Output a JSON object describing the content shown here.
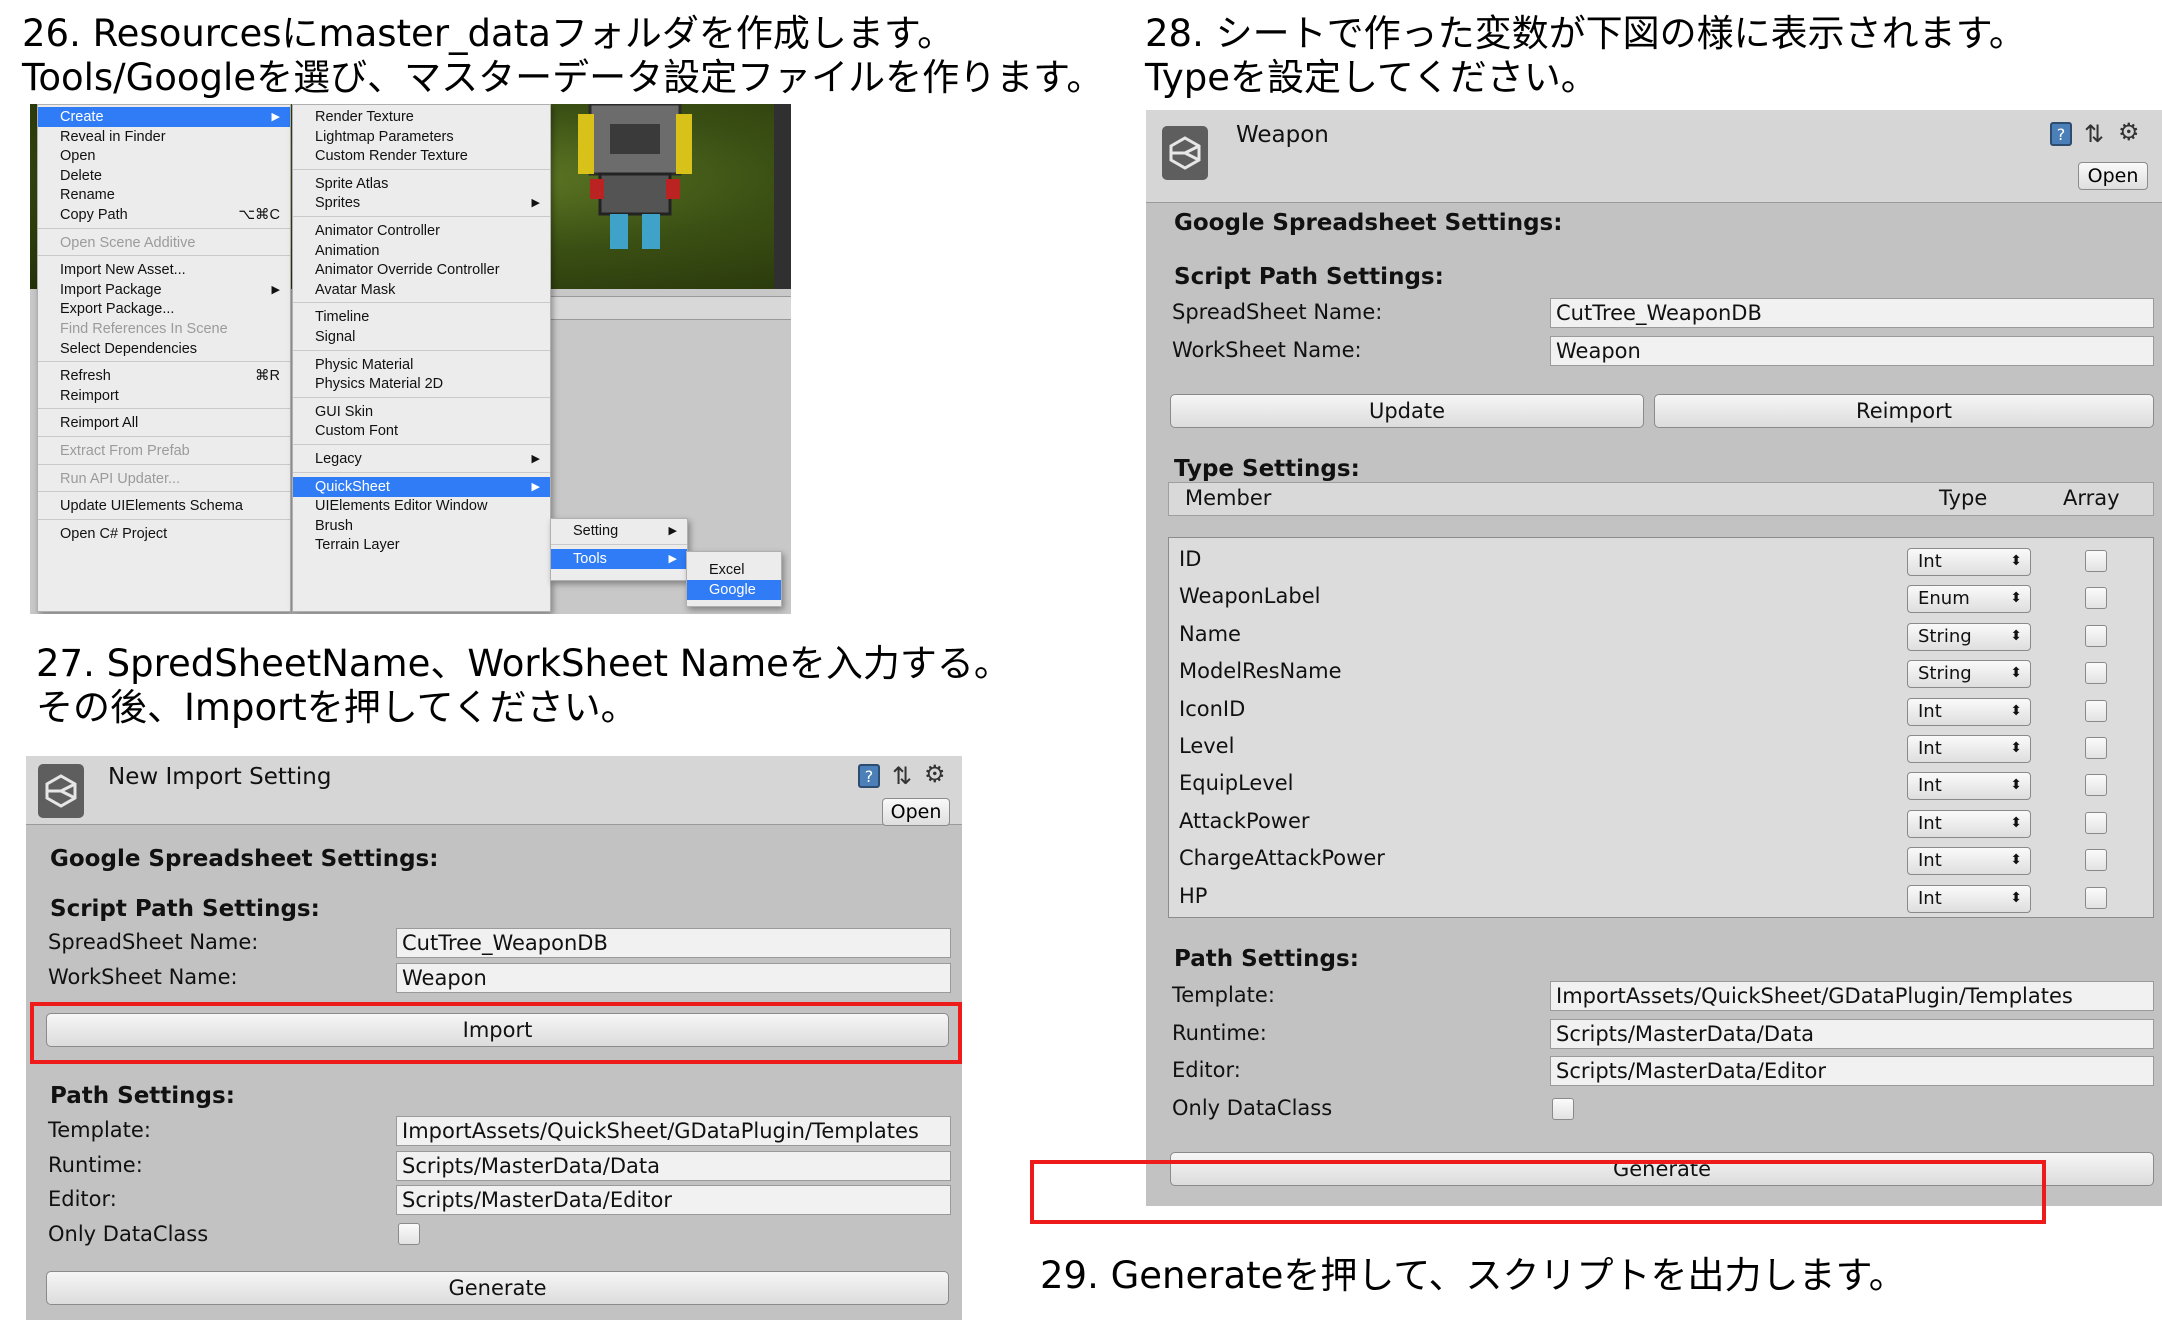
{
  "captions": {
    "step26_line1": "26. Resourcesにmaster_dataフォルダを作成します。",
    "step26_line2": "Tools/Googleを選び、マスターデータ設定ファイルを作ります。",
    "step27_line1": "27. SpredSheetName、WorkSheet Nameを入力する。",
    "step27_line2": "その後、Importを押してください。",
    "step28_line1": "28. シートで作った変数が下図の様に表示されます。",
    "step28_line2": "Typeを設定してください。",
    "step29": "29. Generateを押して、スクリプトを出力します。"
  },
  "context_menu": {
    "main": [
      {
        "label": "Create",
        "selected": true,
        "arrow": "▶"
      },
      {
        "label": "Reveal in Finder"
      },
      {
        "label": "Open"
      },
      {
        "label": "Delete"
      },
      {
        "label": "Rename"
      },
      {
        "label": "Copy Path",
        "shortcut": "⌥⌘C"
      },
      {
        "label": "Open Scene Additive",
        "disabled": true
      },
      {
        "label": "Import New Asset..."
      },
      {
        "label": "Import Package",
        "arrow": "▶"
      },
      {
        "label": "Export Package..."
      },
      {
        "label": "Find References In Scene",
        "disabled": true
      },
      {
        "label": "Select Dependencies"
      },
      {
        "label": "Refresh",
        "shortcut": "⌘R"
      },
      {
        "label": "Reimport"
      },
      {
        "label": "Reimport All"
      },
      {
        "label": "Extract From Prefab",
        "disabled": true
      },
      {
        "label": "Run API Updater...",
        "disabled": true
      },
      {
        "label": "Update UIElements Schema"
      },
      {
        "label": "Open C# Project"
      }
    ],
    "create_sub": [
      {
        "label": "Render Texture"
      },
      {
        "label": "Lightmap Parameters"
      },
      {
        "label": "Custom Render Texture"
      },
      {
        "label": "Sprite Atlas"
      },
      {
        "label": "Sprites",
        "arrow": "▶"
      },
      {
        "label": "Animator Controller"
      },
      {
        "label": "Animation"
      },
      {
        "label": "Animator Override Controller"
      },
      {
        "label": "Avatar Mask"
      },
      {
        "label": "Timeline"
      },
      {
        "label": "Signal"
      },
      {
        "label": "Physic Material"
      },
      {
        "label": "Physics Material 2D"
      },
      {
        "label": "GUI Skin"
      },
      {
        "label": "Custom Font"
      },
      {
        "label": "Legacy",
        "arrow": "▶"
      },
      {
        "label": "QuickSheet",
        "selected": true,
        "arrow": "▶"
      },
      {
        "label": "UIElements Editor Window"
      },
      {
        "label": "Brush"
      },
      {
        "label": "Terrain Layer"
      }
    ],
    "quicksheet_sub": [
      {
        "label": "Setting",
        "arrow": "▶"
      },
      {
        "label": "Tools",
        "selected": true,
        "arrow": "▶"
      }
    ],
    "tools_sub": [
      {
        "label": "Excel"
      },
      {
        "label": "Google",
        "selected": true
      }
    ]
  },
  "import_panel": {
    "title": "New Import Setting",
    "open_label": "Open",
    "help_glyph": "?",
    "google_section": "Google Spreadsheet Settings:",
    "script_path_section": "Script Path Settings:",
    "spreadsheet_label": "SpreadSheet Name:",
    "spreadsheet_value": "CutTree_WeaponDB",
    "worksheet_label": "WorkSheet Name:",
    "worksheet_value": "Weapon",
    "import_label": "Import",
    "path_section": "Path Settings:",
    "template_label": "Template:",
    "template_value": "ImportAssets/QuickSheet/GDataPlugin/Templates",
    "runtime_label": "Runtime:",
    "runtime_value": "Scripts/MasterData/Data",
    "editor_label": "Editor:",
    "editor_value": "Scripts/MasterData/Editor",
    "only_dataclass_label": "Only DataClass",
    "generate_label": "Generate"
  },
  "weapon_panel": {
    "title": "Weapon",
    "open_label": "Open",
    "help_glyph": "?",
    "google_section": "Google Spreadsheet Settings:",
    "script_path_section": "Script Path Settings:",
    "spreadsheet_label": "SpreadSheet Name:",
    "spreadsheet_value": "CutTree_WeaponDB",
    "worksheet_label": "WorkSheet Name:",
    "worksheet_value": "Weapon",
    "update_label": "Update",
    "reimport_label": "Reimport",
    "type_section": "Type Settings:",
    "col_member": "Member",
    "col_type": "Type",
    "col_array": "Array",
    "members": [
      {
        "name": "ID",
        "type": "Int"
      },
      {
        "name": "WeaponLabel",
        "type": "Enum"
      },
      {
        "name": "Name",
        "type": "String"
      },
      {
        "name": "ModelResName",
        "type": "String"
      },
      {
        "name": "IconID",
        "type": "Int"
      },
      {
        "name": "Level",
        "type": "Int"
      },
      {
        "name": "EquipLevel",
        "type": "Int"
      },
      {
        "name": "AttackPower",
        "type": "Int"
      },
      {
        "name": "ChargeAttackPower",
        "type": "Int"
      },
      {
        "name": "HP",
        "type": "Int"
      }
    ],
    "select_arrows": "⬍",
    "path_section": "Path Settings:",
    "template_label": "Template:",
    "template_value": "ImportAssets/QuickSheet/GDataPlugin/Templates",
    "runtime_label": "Runtime:",
    "runtime_value": "Scripts/MasterData/Data",
    "editor_label": "Editor:",
    "editor_value": "Scripts/MasterData/Editor",
    "only_dataclass_label": "Only DataClass",
    "generate_label": "Generate"
  },
  "colors": {
    "highlight_box": "#ee1b1b",
    "menu_selection": "#2f7cf6",
    "panel_background": "#c2c2c2"
  }
}
